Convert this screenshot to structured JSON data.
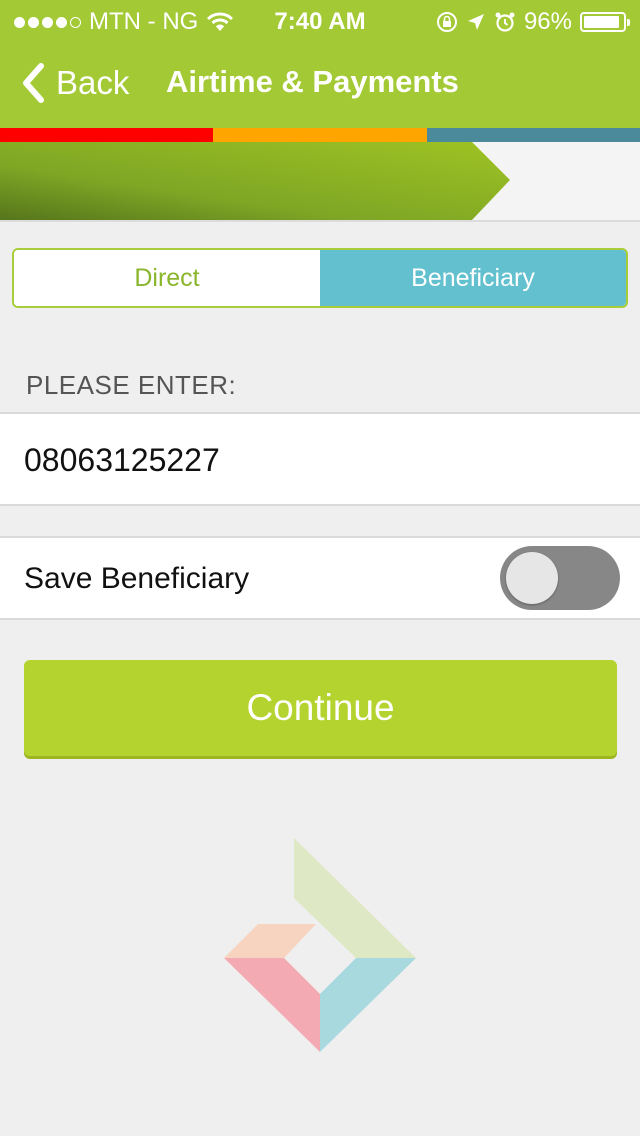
{
  "status_bar": {
    "carrier": "MTN - NG",
    "time": "7:40 AM",
    "battery_percent": "96%",
    "signal_bars_filled": 4,
    "signal_bars_total": 5
  },
  "navbar": {
    "back_label": "Back",
    "title": "Airtime & Payments"
  },
  "colors": {
    "header": "#a3c935",
    "strip": [
      "#ff0000",
      "#ffa500",
      "#4a8a9a"
    ],
    "segment_selected": "#62c0cf",
    "continue_button": "#b4d32e",
    "toggle_off": "#878787"
  },
  "segment": {
    "options": [
      "Direct",
      "Beneficiary"
    ],
    "selected": "Beneficiary"
  },
  "form": {
    "section_label": "PLEASE ENTER:",
    "phone_value": "08063125227",
    "save_beneficiary_label": "Save Beneficiary",
    "save_beneficiary_on": false,
    "continue_label": "Continue"
  },
  "icons": {
    "back": "chevron-left-icon",
    "wifi": "wifi-icon",
    "lock_rotation": "rotation-lock-icon",
    "location": "location-arrow-icon",
    "alarm": "alarm-icon",
    "battery": "battery-icon",
    "logo": "brand-logo-icon"
  }
}
